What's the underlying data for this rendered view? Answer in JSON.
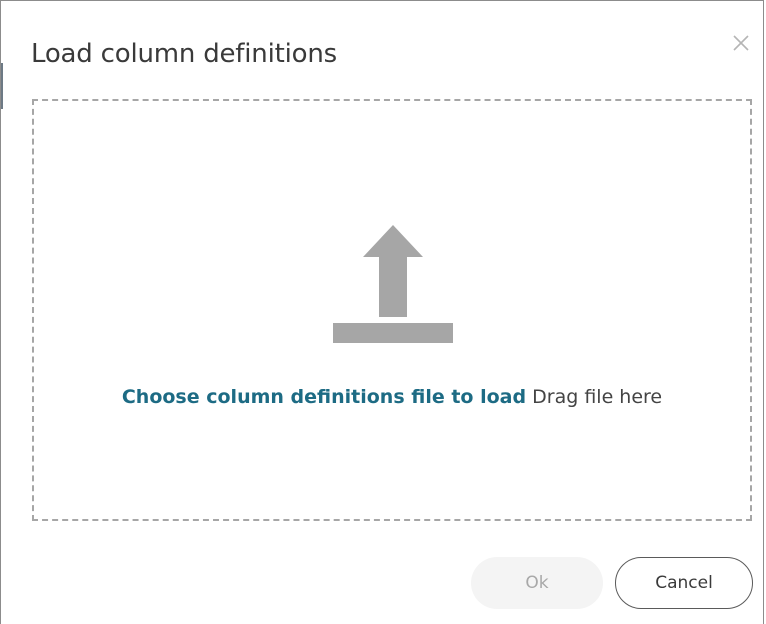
{
  "dialog": {
    "title": "Load column definitions",
    "close_icon": "close-icon"
  },
  "dropzone": {
    "icon": "upload-icon",
    "choose_link": "Choose column definitions file to load",
    "drag_text": "Drag file here"
  },
  "footer": {
    "ok_label": "Ok",
    "cancel_label": "Cancel"
  },
  "colors": {
    "link": "#1d6b84",
    "icon": "#a6a6a6",
    "dashed_border": "#a6a6a6",
    "disabled_button_bg": "#f4f4f4"
  }
}
